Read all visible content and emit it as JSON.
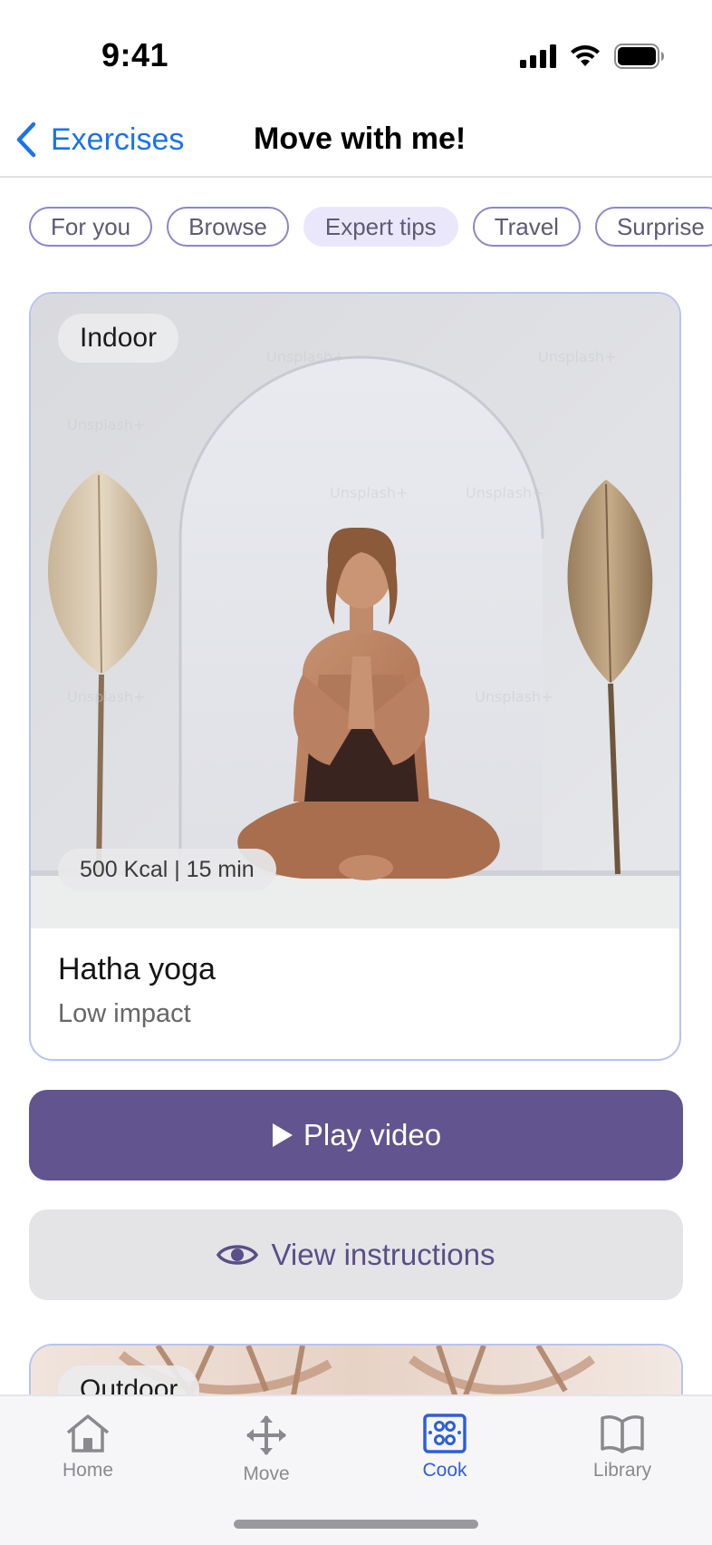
{
  "status_bar": {
    "time": "9:41"
  },
  "nav": {
    "back_label": "Exercises",
    "title": "Move with me!"
  },
  "chips": [
    {
      "label": "For you",
      "selected": false
    },
    {
      "label": "Browse",
      "selected": false
    },
    {
      "label": "Expert tips",
      "selected": true
    },
    {
      "label": "Travel",
      "selected": false
    },
    {
      "label": "Surprise",
      "selected": false
    }
  ],
  "card": {
    "tag": "Indoor",
    "stats": "500 Kcal | 15 min",
    "title": "Hatha yoga",
    "subtitle": "Low impact"
  },
  "actions": {
    "play_label": "Play video",
    "instructions_label": "View instructions"
  },
  "next_card": {
    "tag": "Outdoor"
  },
  "tab_bar": {
    "items": [
      {
        "label": "Home",
        "icon": "home-icon",
        "active": false
      },
      {
        "label": "Move",
        "icon": "move-icon",
        "active": false
      },
      {
        "label": "Cook",
        "icon": "cook-icon",
        "active": true
      },
      {
        "label": "Library",
        "icon": "book-icon",
        "active": false
      }
    ]
  },
  "colors": {
    "accent": "#1a73e8",
    "primary_button": "#62548e",
    "chip_border": "#8d86c9",
    "chip_selected": "#ebe7fb",
    "card_border": "#b9c3ef",
    "tab_active": "#2e5fd8"
  }
}
